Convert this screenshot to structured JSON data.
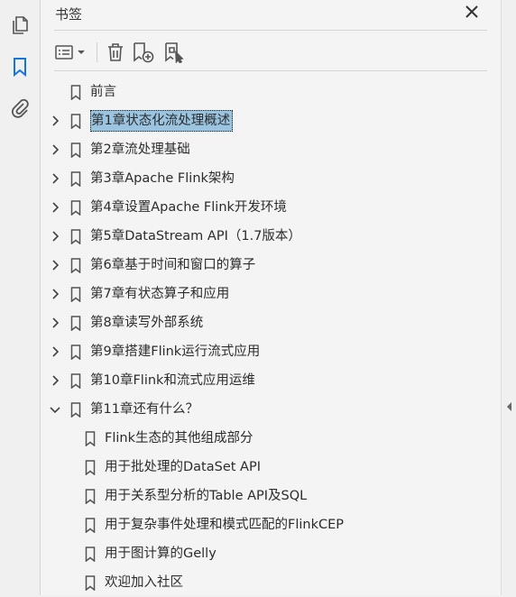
{
  "panel": {
    "title": "书签"
  },
  "leftbar": {
    "icons": [
      "pages-icon",
      "bookmark-icon",
      "attachment-icon"
    ],
    "active_color": "#1473e6"
  },
  "toolbar": {
    "items": [
      "options-menu-icon",
      "delete-icon",
      "new-bookmark-icon",
      "new-bookmark-from-structure-icon"
    ]
  },
  "bookmarks": [
    {
      "label": "前言",
      "level": 0,
      "expandable": false
    },
    {
      "label": "第1章状态化流处理概述",
      "level": 0,
      "expandable": true,
      "expanded": false,
      "selected": true
    },
    {
      "label": "第2章流处理基础",
      "level": 0,
      "expandable": true,
      "expanded": false
    },
    {
      "label": "第3章Apache Flink架构",
      "level": 0,
      "expandable": true,
      "expanded": false
    },
    {
      "label": "第4章设置Apache Flink开发环境",
      "level": 0,
      "expandable": true,
      "expanded": false
    },
    {
      "label": "第5章DataStream API（1.7版本）",
      "level": 0,
      "expandable": true,
      "expanded": false
    },
    {
      "label": "第6章基于时间和窗口的算子",
      "level": 0,
      "expandable": true,
      "expanded": false
    },
    {
      "label": "第7章有状态算子和应用",
      "level": 0,
      "expandable": true,
      "expanded": false
    },
    {
      "label": "第8章读写外部系统",
      "level": 0,
      "expandable": true,
      "expanded": false
    },
    {
      "label": "第9章搭建Flink运行流式应用",
      "level": 0,
      "expandable": true,
      "expanded": false
    },
    {
      "label": "第10章Flink和流式应用运维",
      "level": 0,
      "expandable": true,
      "expanded": false
    },
    {
      "label": "第11章还有什么？",
      "level": 0,
      "expandable": true,
      "expanded": true
    },
    {
      "label": "Flink生态的其他组成部分",
      "level": 1,
      "expandable": false
    },
    {
      "label": "用于批处理的DataSet API",
      "level": 1,
      "expandable": false
    },
    {
      "label": "用于关系型分析的Table API及SQL",
      "level": 1,
      "expandable": false
    },
    {
      "label": "用于复杂事件处理和模式匹配的FlinkCEP",
      "level": 1,
      "expandable": false
    },
    {
      "label": "用于图计算的Gelly",
      "level": 1,
      "expandable": false
    },
    {
      "label": "欢迎加入社区",
      "level": 1,
      "expandable": false
    }
  ],
  "colors": {
    "selection": "#9ac4e0",
    "icon": "#5a5a5a"
  }
}
